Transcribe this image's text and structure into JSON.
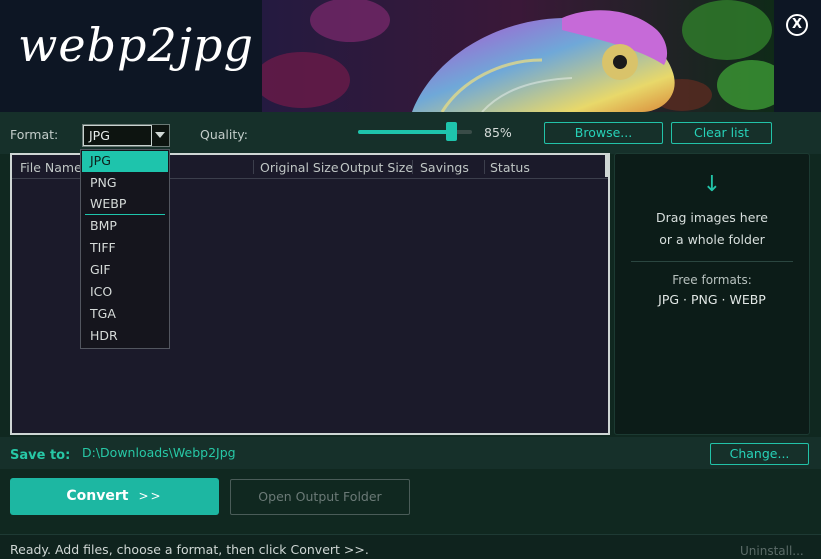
{
  "app": {
    "logo_text": "webp2jpg",
    "close_label": "X"
  },
  "toolbar": {
    "format_label": "Format:",
    "format_selected": "JPG",
    "quality_label": "Quality:",
    "quality_value": 85,
    "quality_text": "85%",
    "browse_label": "Browse...",
    "clear_label": "Clear list"
  },
  "format_dropdown": {
    "options": [
      "JPG",
      "PNG",
      "WEBP",
      "BMP",
      "TIFF",
      "GIF",
      "ICO",
      "TGA",
      "HDR"
    ],
    "selected_index": 0
  },
  "file_list": {
    "columns": [
      "File Name",
      "Original Size",
      "Output Size",
      "Savings",
      "Status"
    ],
    "rows": []
  },
  "drop_zone": {
    "arrow": "↓",
    "line1": "Drag images here",
    "line2": "or a whole folder",
    "free_title": "Free formats:",
    "free_list": "JPG · PNG · WEBP"
  },
  "save_to": {
    "label": "Save to:",
    "path": "D:\\Downloads\\Webp2Jpg",
    "change_label": "Change..."
  },
  "actions": {
    "convert_label": "Convert",
    "convert_arrows": ">>",
    "open_folder_label": "Open Output Folder"
  },
  "status": {
    "text": "Ready.  Add files, choose a format, then click  Convert >>.",
    "uninstall_label": "Uninstall..."
  },
  "colors": {
    "accent": "#1ec4ac",
    "background": "#102820",
    "list_background": "#1b1a2a"
  }
}
